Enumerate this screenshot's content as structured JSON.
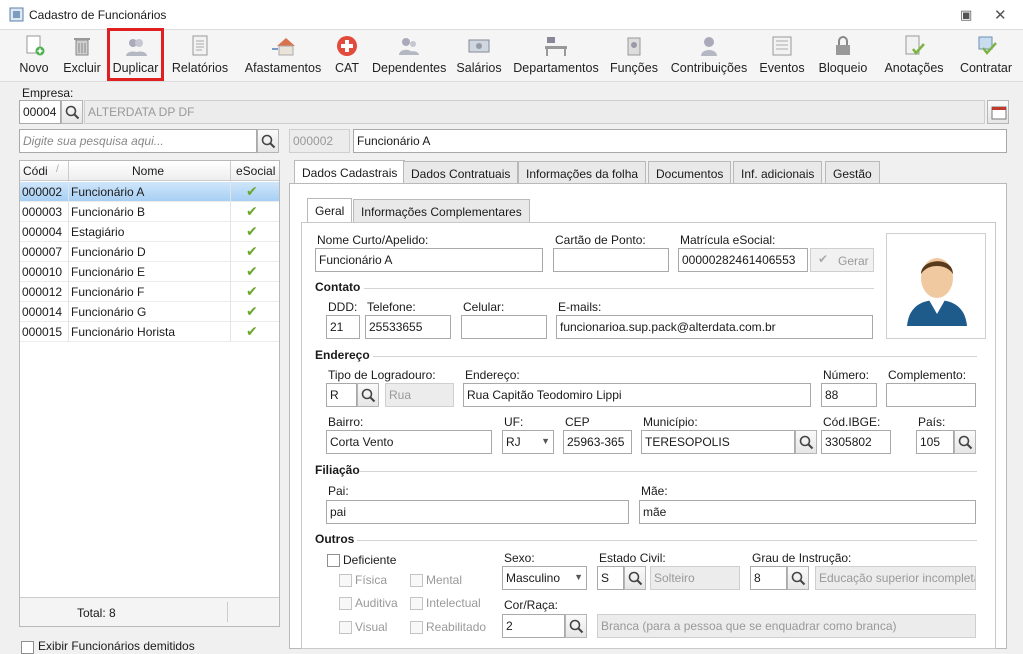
{
  "window": {
    "title": "Cadastro de Funcionários"
  },
  "toolbar": {
    "novo": "Novo",
    "excluir": "Excluir",
    "duplicar": "Duplicar",
    "relatorios": "Relatórios",
    "afastamentos": "Afastamentos",
    "cat": "CAT",
    "dependentes": "Dependentes",
    "salarios": "Salários",
    "departamentos": "Departamentos",
    "funcoes": "Funções",
    "contribuicoes": "Contribuições",
    "eventos": "Eventos",
    "bloqueio": "Bloqueio",
    "anotacoes": "Anotações",
    "contratar": "Contratar"
  },
  "empresa": {
    "label": "Empresa:",
    "code": "00004",
    "name": "ALTERDATA DP  DF"
  },
  "search": {
    "placeholder": "Digite sua pesquisa aqui..."
  },
  "current": {
    "code": "000002",
    "name": "Funcionário A"
  },
  "grid": {
    "headers": {
      "code": "Códi",
      "name": "Nome",
      "esocial": "eSocial"
    },
    "rows": [
      {
        "code": "000002",
        "name": "Funcionário A"
      },
      {
        "code": "000003",
        "name": "Funcionário B"
      },
      {
        "code": "000004",
        "name": "Estagiário"
      },
      {
        "code": "000007",
        "name": "Funcionário D"
      },
      {
        "code": "000010",
        "name": "Funcionário E"
      },
      {
        "code": "000012",
        "name": "Funcionário F"
      },
      {
        "code": "000014",
        "name": "Funcionário G"
      },
      {
        "code": "000015",
        "name": "Funcionário Horista"
      }
    ],
    "total": "Total: 8"
  },
  "show_dismissed": "Exibir Funcionários demitidos",
  "tabs": {
    "dados_cadastrais": "Dados Cadastrais",
    "dados_contratuais": "Dados Contratuais",
    "informacoes_folha": "Informações da folha",
    "documentos": "Documentos",
    "inf_adicionais": "Inf. adicionais",
    "gestao": "Gestão"
  },
  "subtabs": {
    "geral": "Geral",
    "complementares": "Informações Complementares"
  },
  "form": {
    "nome_curto_label": "Nome Curto/Apelido:",
    "nome_curto": "Funcionário A",
    "cartao_label": "Cartão de Ponto:",
    "cartao": "",
    "matricula_label": "Matrícula eSocial:",
    "matricula": "00000282461406553",
    "gerar": "Gerar",
    "contato": "Contato",
    "ddd_label": "DDD:",
    "ddd": "21",
    "telefone_label": "Telefone:",
    "telefone": "25533655",
    "celular_label": "Celular:",
    "celular": "",
    "emails_label": "E-mails:",
    "email": "funcionarioa.sup.pack@alterdata.com.br",
    "endereco": "Endereço",
    "tipo_lograd_label": "Tipo de Logradouro:",
    "tipo_lograd": "R",
    "tipo_lograd_desc": "Rua",
    "endereco_label": "Endereço:",
    "endereco_val": "Rua Capitão Teodomiro Lippi",
    "numero_label": "Número:",
    "numero": "88",
    "complemento_label": "Complemento:",
    "complemento": "",
    "bairro_label": "Bairro:",
    "bairro": "Corta Vento",
    "uf_label": "UF:",
    "uf": "RJ",
    "cep_label": "CEP",
    "cep": "25963-365",
    "municipio_label": "Município:",
    "municipio": "TERESOPOLIS",
    "ibge_label": "Cód.IBGE:",
    "ibge": "3305802",
    "pais_label": "País:",
    "pais": "105",
    "filiacao": "Filiação",
    "pai_label": "Pai:",
    "pai": "pai",
    "mae_label": "Mãe:",
    "mae": "mãe",
    "outros": "Outros",
    "deficiente": "Deficiente",
    "fisica": "Física",
    "mental": "Mental",
    "auditiva": "Auditiva",
    "intelectual": "Intelectual",
    "visual": "Visual",
    "reabilitado": "Reabilitado",
    "sexo_label": "Sexo:",
    "sexo": "Masculino",
    "estado_civil_label": "Estado Civil:",
    "estado_civil": "S",
    "estado_civil_desc": "Solteiro",
    "grau_label": "Grau de Instrução:",
    "grau": "8",
    "grau_desc": "Educação superior incompleta",
    "cor_label": "Cor/Raça:",
    "cor": "2",
    "cor_desc": "Branca (para a pessoa que se enquadrar como branca)"
  },
  "colors": {
    "accent": "#e02020",
    "selection": "#bcdcf7",
    "check": "#6aa82b"
  }
}
